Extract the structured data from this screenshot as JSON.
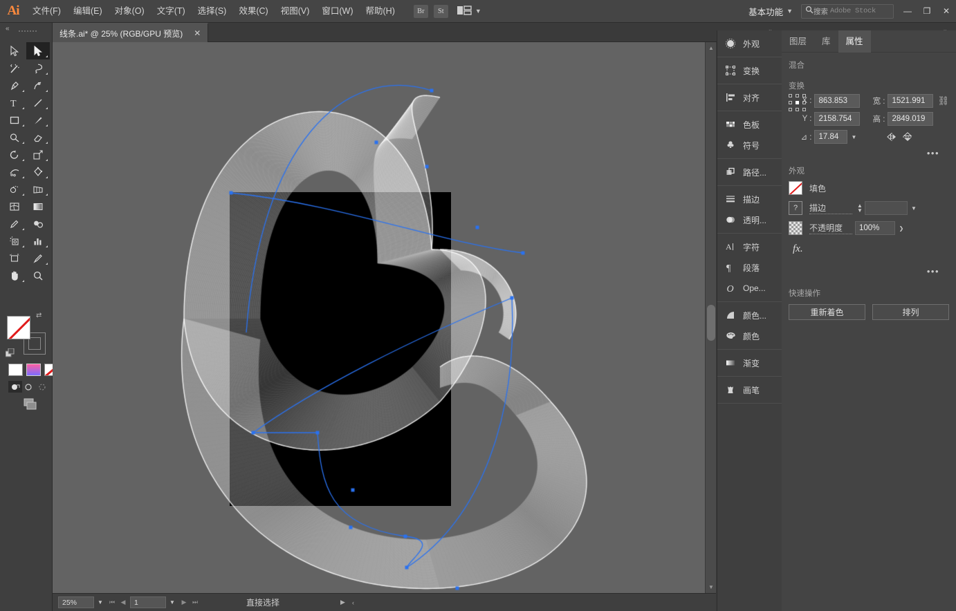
{
  "app": {
    "name": "Adobe Illustrator",
    "logo": "Ai"
  },
  "menubar": {
    "items": [
      {
        "label": "文件(F)"
      },
      {
        "label": "编辑(E)"
      },
      {
        "label": "对象(O)"
      },
      {
        "label": "文字(T)"
      },
      {
        "label": "选择(S)"
      },
      {
        "label": "效果(C)"
      },
      {
        "label": "视图(V)"
      },
      {
        "label": "窗口(W)"
      },
      {
        "label": "帮助(H)"
      }
    ],
    "bridge_label": "Br",
    "stock_label": "St",
    "arrange_icon": "arrange-documents-icon",
    "workspace": "基本功能",
    "search": {
      "prefix": "搜索",
      "placeholder": "Adobe Stock"
    },
    "window_buttons": {
      "minimize": "—",
      "maximize": "❐",
      "close": "✕"
    }
  },
  "tabbar": {
    "document": {
      "title": "线条.ai* @ 25% (RGB/GPU 预览)",
      "close": "✕"
    },
    "left_collapse": "«",
    "panel_collapse": "«",
    "panel_expand": "»"
  },
  "toolbar": {
    "tools": [
      {
        "name": "selection-tool",
        "active": false
      },
      {
        "name": "direct-selection-tool",
        "active": true
      },
      {
        "name": "magic-wand-tool",
        "active": false
      },
      {
        "name": "lasso-tool",
        "active": false
      },
      {
        "name": "pen-tool",
        "active": false
      },
      {
        "name": "curvature-tool",
        "active": false
      },
      {
        "name": "type-tool",
        "active": false
      },
      {
        "name": "line-segment-tool",
        "active": false
      },
      {
        "name": "rectangle-tool",
        "active": false
      },
      {
        "name": "paintbrush-tool",
        "active": false
      },
      {
        "name": "shaper-tool",
        "active": false
      },
      {
        "name": "eraser-tool",
        "active": false
      },
      {
        "name": "rotate-tool",
        "active": false
      },
      {
        "name": "scale-tool",
        "active": false
      },
      {
        "name": "width-tool",
        "active": false
      },
      {
        "name": "free-transform-tool",
        "active": false
      },
      {
        "name": "shape-builder-tool",
        "active": false
      },
      {
        "name": "perspective-grid-tool",
        "active": false
      },
      {
        "name": "mesh-tool",
        "active": false
      },
      {
        "name": "gradient-tool",
        "active": false
      },
      {
        "name": "eyedropper-tool",
        "active": false
      },
      {
        "name": "blend-tool",
        "active": false
      },
      {
        "name": "symbol-sprayer-tool",
        "active": false
      },
      {
        "name": "column-graph-tool",
        "active": false
      },
      {
        "name": "artboard-tool",
        "active": false
      },
      {
        "name": "slice-tool",
        "active": false
      },
      {
        "name": "hand-tool",
        "active": false
      },
      {
        "name": "zoom-tool",
        "active": false
      }
    ],
    "fill_swatch": "none",
    "stroke_swatch": "none",
    "swatch_row": [
      "color-white",
      "gradient",
      "none"
    ],
    "draw_modes": [
      "draw-normal",
      "draw-behind",
      "draw-inside"
    ],
    "screen_mode": "change-screen-mode"
  },
  "canvas": {
    "artboard_fill": "#000000",
    "background": "#636363",
    "selection_color": "#2a72f0",
    "artwork_name": "blend-line-art-ribbon"
  },
  "statusbar": {
    "zoom": "25%",
    "page": "1",
    "tool": "直接选择",
    "nav_first": "⏮",
    "nav_prev": "◀",
    "nav_next": "▶",
    "nav_last": "⏭"
  },
  "icondock": {
    "groups": [
      {
        "items": [
          {
            "label": "外观",
            "icon": "appearance-icon"
          }
        ]
      },
      {
        "items": [
          {
            "label": "变换",
            "icon": "transform-icon"
          }
        ]
      },
      {
        "items": [
          {
            "label": "对齐",
            "icon": "align-icon"
          }
        ]
      },
      {
        "items": [
          {
            "label": "色板",
            "icon": "swatches-icon"
          },
          {
            "label": "符号",
            "icon": "symbols-icon"
          }
        ]
      },
      {
        "items": [
          {
            "label": "路径...",
            "icon": "pathfinder-icon"
          }
        ]
      },
      {
        "items": [
          {
            "label": "描边",
            "icon": "stroke-icon"
          },
          {
            "label": "透明...",
            "icon": "transparency-icon"
          }
        ]
      },
      {
        "items": [
          {
            "label": "字符",
            "icon": "character-icon"
          },
          {
            "label": "段落",
            "icon": "paragraph-icon"
          },
          {
            "label": "Ope...",
            "icon": "opentype-icon"
          }
        ]
      },
      {
        "items": [
          {
            "label": "颜色...",
            "icon": "color-guide-icon"
          },
          {
            "label": "颜色",
            "icon": "color-icon"
          }
        ]
      },
      {
        "items": [
          {
            "label": "渐变",
            "icon": "gradient-icon"
          }
        ]
      },
      {
        "items": [
          {
            "label": "画笔",
            "icon": "brushes-icon"
          }
        ]
      }
    ]
  },
  "properties": {
    "tabs": [
      {
        "label": "图层",
        "selected": false
      },
      {
        "label": "库",
        "selected": false
      },
      {
        "label": "属性",
        "selected": true
      }
    ],
    "blend_section": {
      "title": "混合"
    },
    "transform": {
      "title": "变换",
      "x_label": "X :",
      "x_value": "863.853",
      "y_label": "Y :",
      "y_value": "2158.754",
      "w_label": "宽 :",
      "w_value": "1521.991",
      "h_label": "高 :",
      "h_value": "2849.019",
      "angle_label": "⊿ :",
      "angle_value": "17.84",
      "link_icon": "link-broken-icon",
      "flip_h_icon": "flip-horizontal-icon",
      "flip_v_icon": "flip-vertical-icon",
      "more_icon": "more-options-icon"
    },
    "appearance": {
      "title": "外观",
      "fill_label": "填色",
      "stroke_label": "描边",
      "stroke_weight": "",
      "opacity_label": "不透明度",
      "opacity_value": "100%",
      "fx_label": "fx.",
      "more_icon": "more-options-icon"
    },
    "quick_actions": {
      "title": "快速操作",
      "buttons": [
        {
          "label": "重新着色"
        },
        {
          "label": "排列"
        }
      ]
    }
  }
}
